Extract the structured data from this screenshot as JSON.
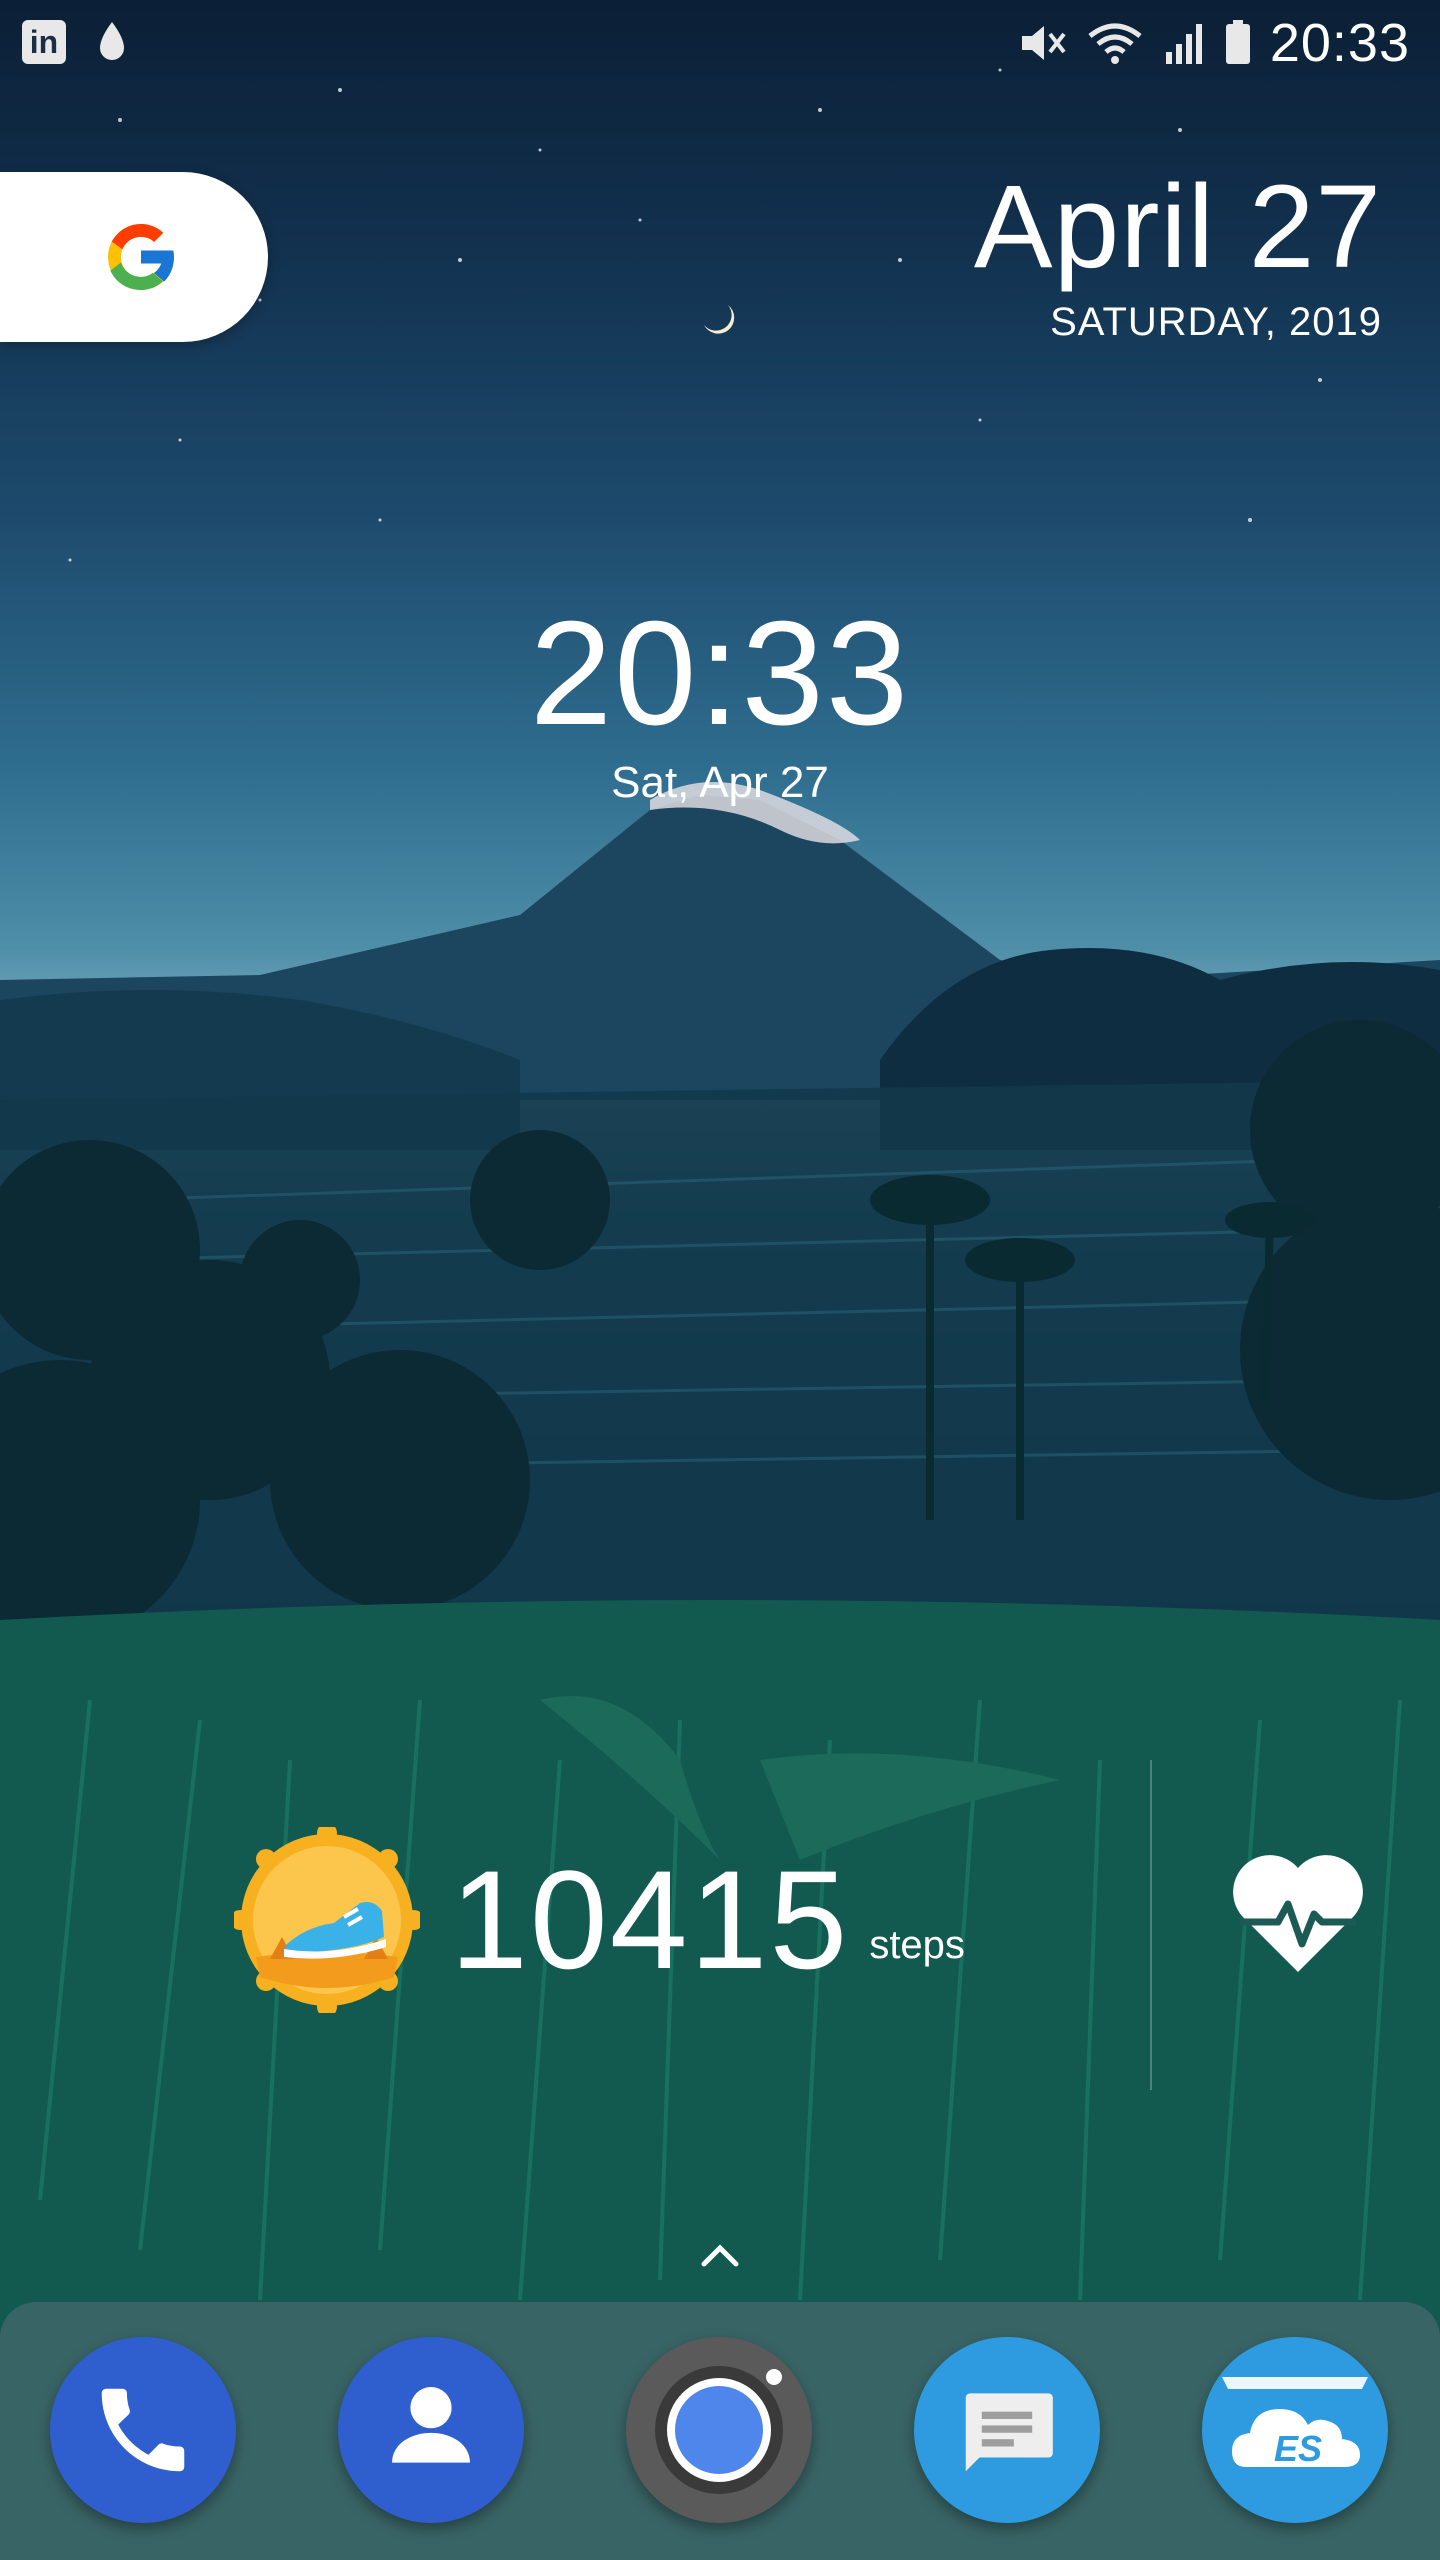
{
  "status_bar": {
    "left_icons": [
      "linkedin-icon",
      "drop-icon"
    ],
    "right_icons": [
      "mute-icon",
      "wifi-icon",
      "signal-icon",
      "battery-icon"
    ],
    "linkedin_glyph": "in",
    "time": "20:33"
  },
  "google_widget": {
    "icon": "google-g-icon"
  },
  "date_widget": {
    "date": "April 27",
    "weekday_year": "SATURDAY, 2019"
  },
  "clock_widget": {
    "time": "20:33",
    "date": "Sat, Apr 27"
  },
  "step_widget": {
    "count": "10415",
    "unit": "steps",
    "badge_icon": "sneaker-badge-icon",
    "health_icon": "heart-pulse-icon"
  },
  "app_drawer": {
    "icon": "chevron-up-icon"
  },
  "dock": {
    "apps": [
      {
        "name": "Phone",
        "icon": "phone-icon",
        "color": "#2f6fd6"
      },
      {
        "name": "Contacts",
        "icon": "contacts-icon",
        "color": "#2f6fd6"
      },
      {
        "name": "Camera",
        "icon": "camera-icon",
        "color": "#5a5a5a"
      },
      {
        "name": "Messages",
        "icon": "messages-icon",
        "color": "#2e9be0"
      },
      {
        "name": "ES File Explorer",
        "icon": "es-cloud-icon",
        "color": "#2e9be0",
        "glyph": "ES"
      }
    ]
  }
}
